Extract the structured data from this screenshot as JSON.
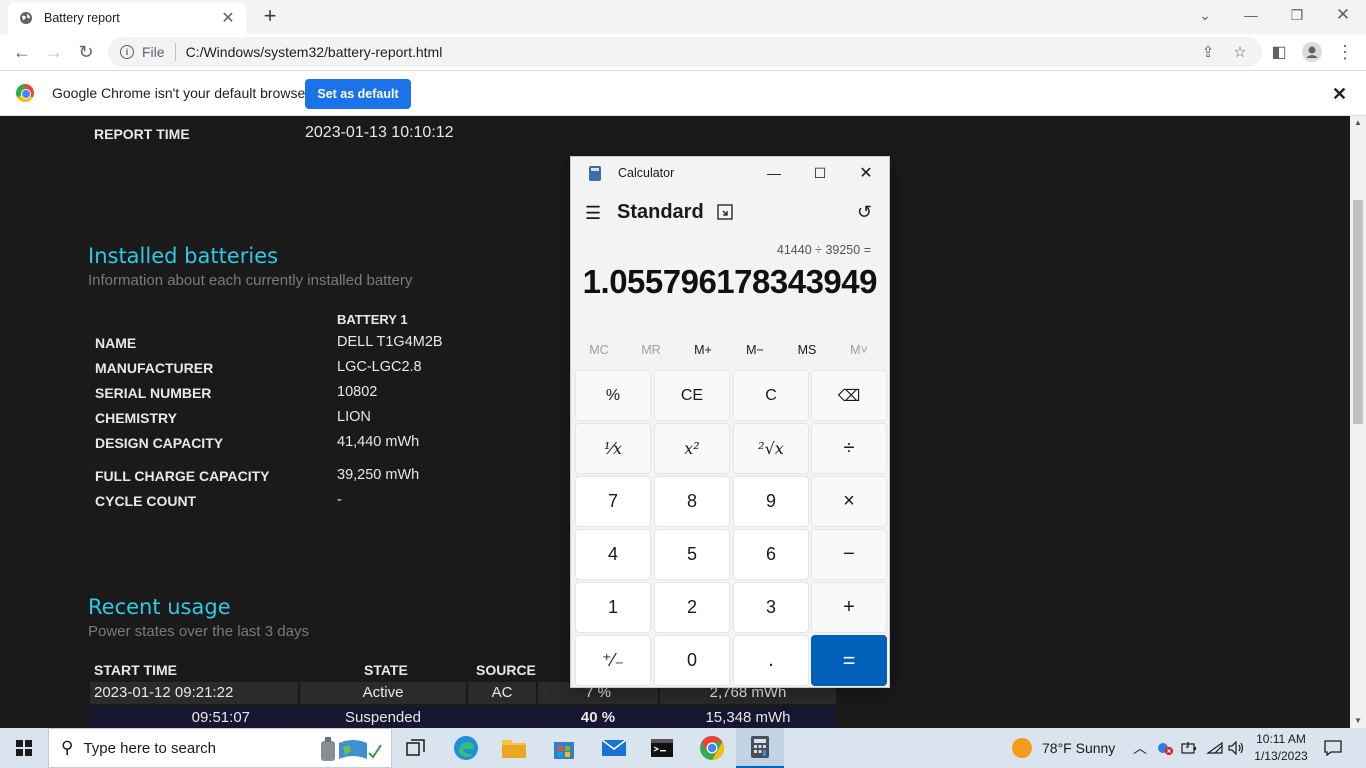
{
  "browser": {
    "tab_title": "Battery report",
    "scheme_label": "File",
    "url": "C:/Windows/system32/battery-report.html",
    "infobar_message": "Google Chrome isn't your default browser",
    "set_default_label": "Set as default"
  },
  "report": {
    "report_time_label": "REPORT TIME",
    "report_time_value": "2023-01-13  10:10:12",
    "installed_title": "Installed batteries",
    "installed_subtitle": "Information about each currently installed battery",
    "battery_header": "BATTERY 1",
    "rows": [
      {
        "label": "NAME",
        "value": "DELL T1G4M2B"
      },
      {
        "label": "MANUFACTURER",
        "value": "LGC-LGC2.8"
      },
      {
        "label": "SERIAL NUMBER",
        "value": "10802"
      },
      {
        "label": "CHEMISTRY",
        "value": "LION"
      },
      {
        "label": "DESIGN CAPACITY",
        "value": "41,440 mWh"
      },
      {
        "label": "FULL CHARGE CAPACITY",
        "value": "39,250 mWh"
      },
      {
        "label": "CYCLE COUNT",
        "value": "-"
      }
    ],
    "recent_title": "Recent usage",
    "recent_subtitle": "Power states over the last 3 days",
    "usage_headers": [
      "START TIME",
      "STATE",
      "SOURCE"
    ],
    "usage_rows": [
      {
        "start": "2023-01-12  09:21:22",
        "state": "Active",
        "source": "AC",
        "percent": "7 %",
        "capacity": "2,768 mWh"
      },
      {
        "start": "09:51:07",
        "state": "Suspended",
        "source": "",
        "percent": "40 %",
        "capacity": "15,348 mWh"
      }
    ]
  },
  "calculator": {
    "window_title": "Calculator",
    "mode": "Standard",
    "expression": "41440 ÷ 39250 =",
    "result": "1.055796178343949",
    "memory": [
      "MC",
      "MR",
      "M+",
      "M−",
      "MS",
      "M˅"
    ],
    "keys": [
      "%",
      "CE",
      "C",
      "⌫",
      "¹⁄x",
      "x²",
      "²√x",
      "÷",
      "7",
      "8",
      "9",
      "×",
      "4",
      "5",
      "6",
      "−",
      "1",
      "2",
      "3",
      "+",
      "⁺⁄₋",
      "0",
      ".",
      "="
    ]
  },
  "taskbar": {
    "search_placeholder": "Type here to search",
    "weather": "78°F  Sunny",
    "time": "10:11 AM",
    "date": "1/13/2023"
  },
  "colors": {
    "accent_cyan": "#2fc9e6",
    "chrome_blue": "#1a73e8",
    "calc_equals": "#005fb8"
  }
}
